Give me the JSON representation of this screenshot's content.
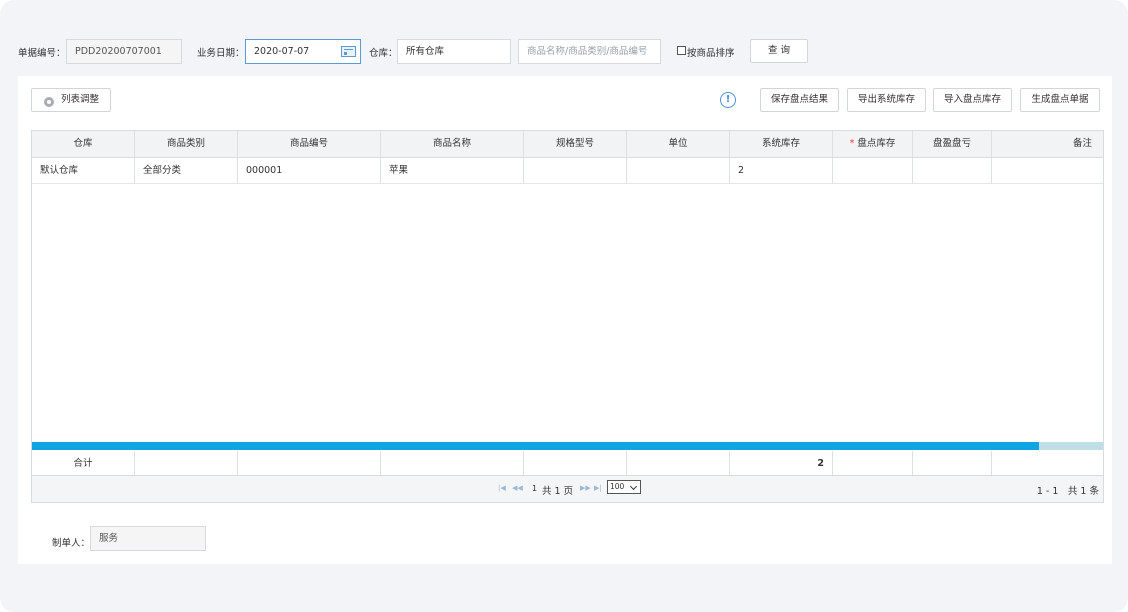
{
  "toolbar": {
    "doc_no_label": "单据编号：",
    "doc_no_value": "PDD20200707001",
    "date_label": "业务日期：",
    "date_value": "2020-07-07",
    "warehouse_label": "仓库：",
    "warehouse_value": "所有仓库",
    "search_placeholder": "商品名称/商品类别/商品编号",
    "sort_label": "按商品排序",
    "sort_checked": false,
    "query_button": "查 询"
  },
  "actions": {
    "column_adjust": "列表调整",
    "info_icon": "info-icon",
    "save_result": "保存盘点结果",
    "export_stock": "导出系统库存",
    "import_count": "导入盘点库存",
    "generate_doc": "生成盘点单据"
  },
  "table": {
    "columns": [
      "仓库",
      "商品类别",
      "商品编号",
      "商品名称",
      "规格型号",
      "单位",
      "系统库存",
      "盘点库存",
      "盘盈盘亏",
      "备注"
    ],
    "required_marker": "*",
    "rows": [
      [
        "默认仓库",
        "全部分类",
        "000001",
        "苹果",
        "",
        "",
        "2",
        "",
        "",
        ""
      ]
    ],
    "footer_label": "合计",
    "footer_total": "2",
    "scroll_fraction": 0.94
  },
  "pager": {
    "page_input": "1",
    "page_total_text": "共 1 页",
    "page_size": "100",
    "range_text": "1 - 1　共 1 条"
  },
  "maker": {
    "label": "制单人：",
    "value": "服务"
  },
  "colors": {
    "accent": "#0ea5e2",
    "required": "#e53935",
    "icon_blue": "#4a90d9"
  }
}
